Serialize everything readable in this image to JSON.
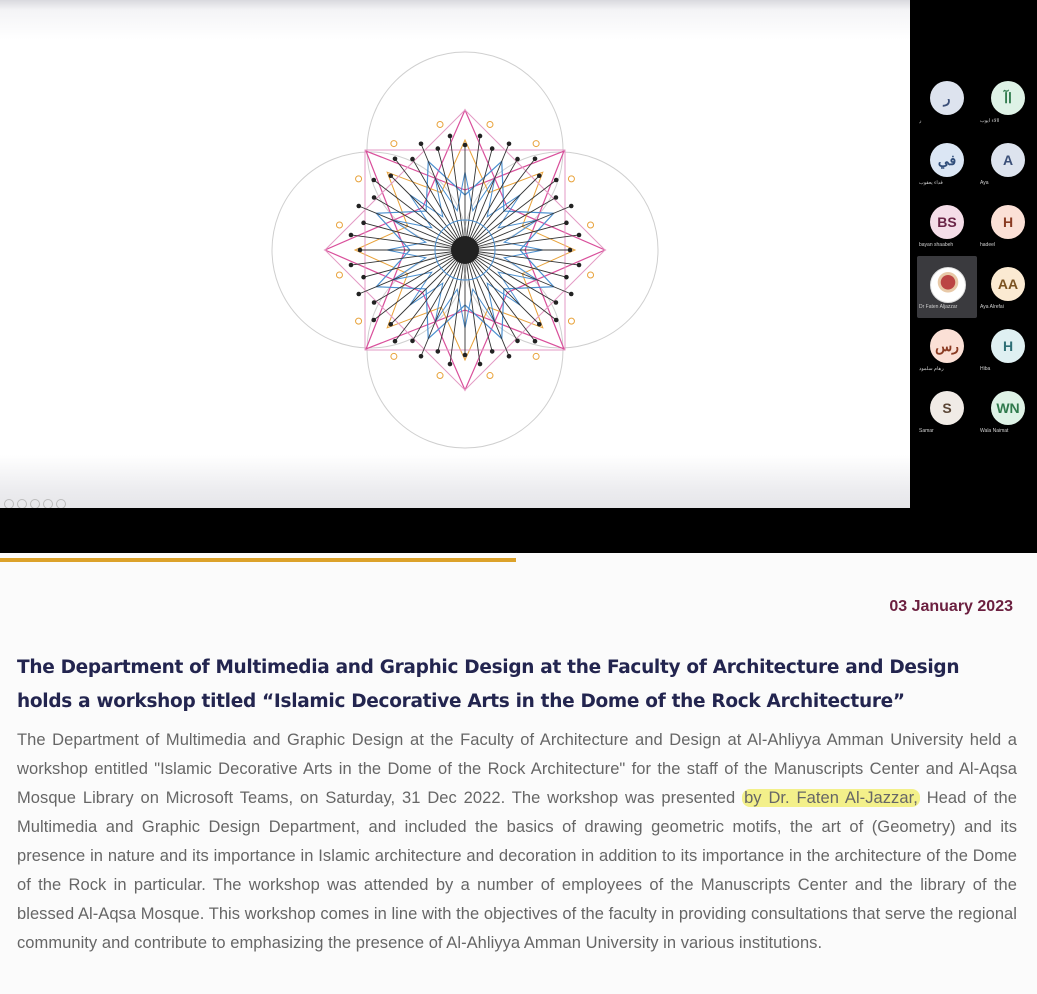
{
  "meeting": {
    "participants": [
      {
        "initials": "ر",
        "name": "ر",
        "bg": "#dde3ee",
        "fg": "#3b4f78"
      },
      {
        "initials": "اآ",
        "name": "اآلاء ايوب",
        "bg": "#def2e6",
        "fg": "#2f7a4c"
      },
      {
        "initials": "في",
        "name": "فداء يعقوب",
        "bg": "#dbe6f4",
        "fg": "#2f4d7a"
      },
      {
        "initials": "A",
        "name": "Aya",
        "bg": "#dde3ee",
        "fg": "#3b4f78"
      },
      {
        "initials": "BS",
        "name": "bayan shaabeh",
        "bg": "#f4dde8",
        "fg": "#6a2447"
      },
      {
        "initials": "H",
        "name": "hadeel",
        "bg": "#fbe0d6",
        "fg": "#8a3a22"
      },
      {
        "initials": "",
        "name": "Dr Faten Aljazzar",
        "bg": "#ffffff",
        "fg": "#000000"
      },
      {
        "initials": "AA",
        "name": "Aya Alrefai",
        "bg": "#fbead2",
        "fg": "#7b5220"
      },
      {
        "initials": "رس",
        "name": "رهام سلمود",
        "bg": "#fbe0d6",
        "fg": "#8a3a22"
      },
      {
        "initials": "H",
        "name": "Hiba",
        "bg": "#dff0f2",
        "fg": "#2d6e75"
      },
      {
        "initials": "S",
        "name": "Samar",
        "bg": "#f0ebe6",
        "fg": "#5a4535"
      },
      {
        "initials": "WN",
        "name": "Wala Naimat",
        "bg": "#def2e6",
        "fg": "#2f7a4c"
      }
    ]
  },
  "article": {
    "date": "03 January 2023",
    "title": "The Department of Multimedia and Graphic Design at the Faculty of Architecture and Design holds a workshop titled “Islamic Decorative Arts in the Dome of the Rock Architecture”",
    "body_before": "The Department of Multimedia and Graphic Design at the Faculty of Architecture and Design at Al-Ahliyya Amman University held a workshop entitled \"Islamic Decorative Arts in the Dome of the Rock Architecture\" for the staff of the Manuscripts Center and Al-Aqsa Mosque Library on Microsoft Teams, on Saturday, 31 Dec 2022. The workshop was presented ",
    "body_highlight": "by Dr. Faten Al-Jazzar,",
    "body_after": " Head of the Multimedia and Graphic Design Department, and included the basics of drawing geometric motifs, the art of (Geometry) and its presence in nature and its importance in Islamic architecture and decoration in addition to its importance in the architecture of the Dome of the Rock in particular. The workshop was attended by a number of employees of the Manuscripts Center and the library of the blessed Al-Aqsa Mosque. This workshop comes in line with the objectives of the faculty in providing consultations that serve the regional community and contribute to emphasizing the presence of Al-Ahliyya Amman University in various institutions."
  },
  "colors": {
    "accent": "#dca22a",
    "date": "#6b1f3f",
    "title": "#23254f",
    "highlight": "#f3f08a"
  },
  "icons": [
    "zoom-in-icon",
    "edit-icon",
    "view-icon",
    "grid-icon",
    "minimize-icon"
  ]
}
